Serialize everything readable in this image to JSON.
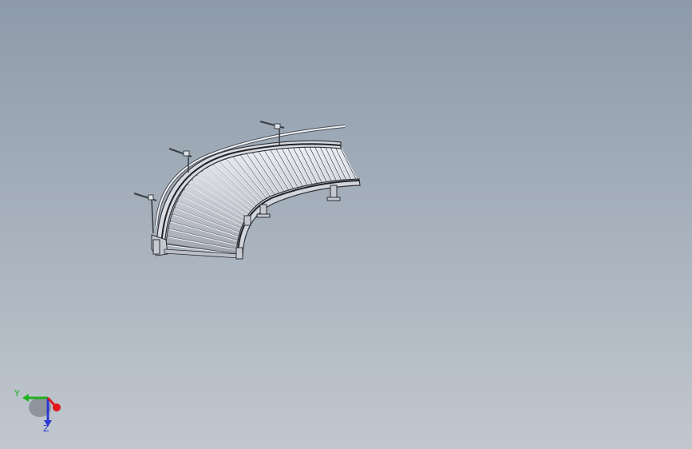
{
  "view": {
    "background_top": "#8d9aa9",
    "background_bottom": "#c1c7ce"
  },
  "model": {
    "name_icon": "curved-roller-conveyor"
  },
  "triad": {
    "y_label": "Y",
    "z_label": "Z",
    "x_color": "#e0171b",
    "y_color": "#21b021",
    "z_color": "#2a38d6"
  }
}
